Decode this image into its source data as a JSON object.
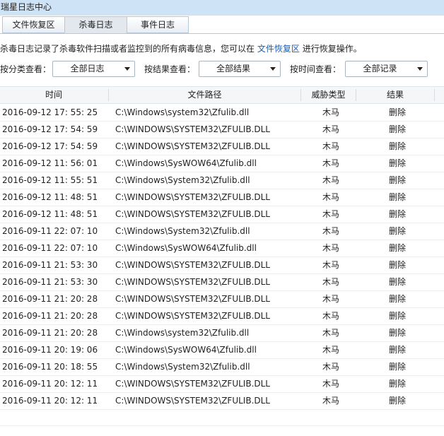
{
  "window": {
    "title": "瑞星日志中心"
  },
  "tabs": [
    {
      "label": "文件恢复区"
    },
    {
      "label": "杀毒日志"
    },
    {
      "label": "事件日志"
    }
  ],
  "info": {
    "text_before": "杀毒日志记录了杀毒软件扫描或者监控到的所有病毒信息，您可以在",
    "link": "文件恢复区",
    "text_after": "进行恢复操作。"
  },
  "filters": {
    "category_label": "按分类查看：",
    "category_value": "全部日志",
    "result_label": "按结果查看：",
    "result_value": "全部结果",
    "time_label": "按时间查看：",
    "time_value": "全部记录"
  },
  "table": {
    "columns": [
      "时间",
      "文件路径",
      "威胁类型",
      "结果"
    ],
    "rows": [
      [
        "2016-09-12 17: 55: 25",
        "C:\\Windows\\system32\\Zfulib.dll",
        "木马",
        "删除"
      ],
      [
        "2016-09-12 17: 54: 59",
        "C:\\WINDOWS\\SYSTEM32\\ZFULIB.DLL",
        "木马",
        "删除"
      ],
      [
        "2016-09-12 17: 54: 59",
        "C:\\WINDOWS\\SYSTEM32\\ZFULIB.DLL",
        "木马",
        "删除"
      ],
      [
        "2016-09-12 11: 56: 01",
        "C:\\Windows\\SysWOW64\\Zfulib.dll",
        "木马",
        "删除"
      ],
      [
        "2016-09-12 11: 55: 51",
        "C:\\Windows\\System32\\Zfulib.dll",
        "木马",
        "删除"
      ],
      [
        "2016-09-12 11: 48: 51",
        "C:\\WINDOWS\\SYSTEM32\\ZFULIB.DLL",
        "木马",
        "删除"
      ],
      [
        "2016-09-12 11: 48: 51",
        "C:\\WINDOWS\\SYSTEM32\\ZFULIB.DLL",
        "木马",
        "删除"
      ],
      [
        "2016-09-11 22: 07: 10",
        "C:\\Windows\\System32\\Zfulib.dll",
        "木马",
        "删除"
      ],
      [
        "2016-09-11 22: 07: 10",
        "C:\\Windows\\SysWOW64\\Zfulib.dll",
        "木马",
        "删除"
      ],
      [
        "2016-09-11 21: 53: 30",
        "C:\\WINDOWS\\SYSTEM32\\ZFULIB.DLL",
        "木马",
        "删除"
      ],
      [
        "2016-09-11 21: 53: 30",
        "C:\\WINDOWS\\SYSTEM32\\ZFULIB.DLL",
        "木马",
        "删除"
      ],
      [
        "2016-09-11 21: 20: 28",
        "C:\\WINDOWS\\SYSTEM32\\ZFULIB.DLL",
        "木马",
        "删除"
      ],
      [
        "2016-09-11 21: 20: 28",
        "C:\\WINDOWS\\SYSTEM32\\ZFULIB.DLL",
        "木马",
        "删除"
      ],
      [
        "2016-09-11 21: 20: 28",
        "C:\\Windows\\system32\\Zfulib.dll",
        "木马",
        "删除"
      ],
      [
        "2016-09-11 20: 19: 06",
        "C:\\Windows\\SysWOW64\\Zfulib.dll",
        "木马",
        "删除"
      ],
      [
        "2016-09-11 20: 18: 55",
        "C:\\Windows\\System32\\Zfulib.dll",
        "木马",
        "删除"
      ],
      [
        "2016-09-11 20: 12: 11",
        "C:\\WINDOWS\\SYSTEM32\\ZFULIB.DLL",
        "木马",
        "删除"
      ],
      [
        "2016-09-11 20: 12: 11",
        "C:\\WINDOWS\\SYSTEM32\\ZFULIB.DLL",
        "木马",
        "删除"
      ]
    ]
  },
  "colors": {
    "title_bar": "#cfe3f7",
    "link": "#1a5db5"
  }
}
